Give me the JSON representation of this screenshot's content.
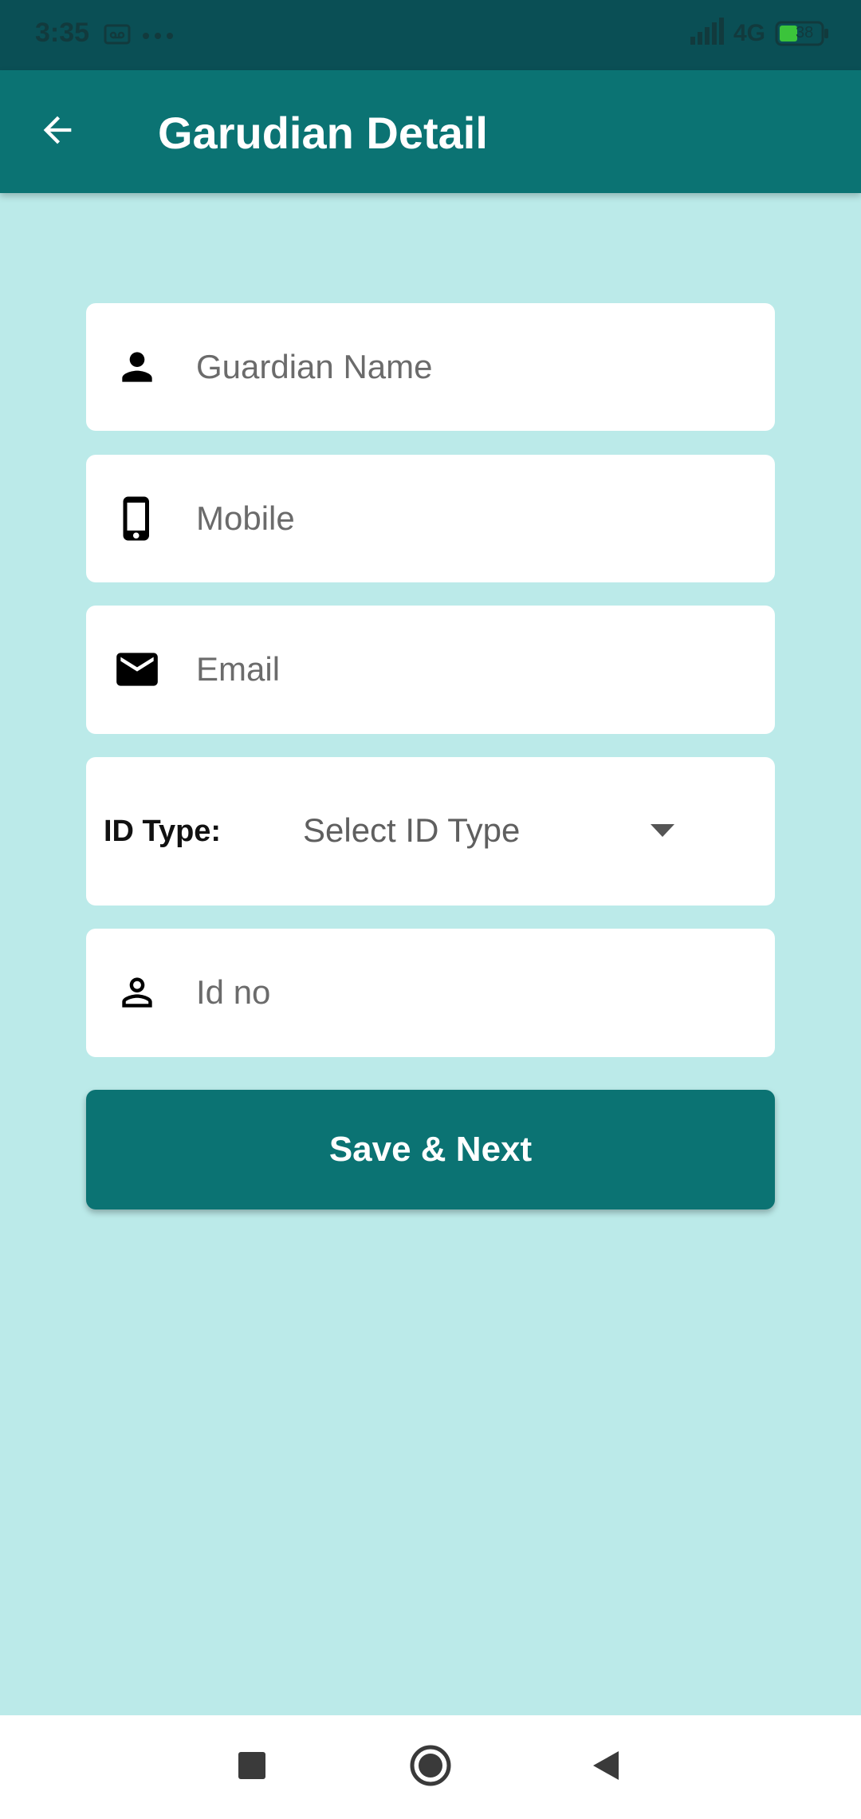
{
  "status_bar": {
    "time": "3:35",
    "network": "4G",
    "battery": "38"
  },
  "app_bar": {
    "title": "Garudian Detail"
  },
  "form": {
    "guardian_name": {
      "placeholder": "Guardian Name",
      "icon": "person-icon"
    },
    "mobile": {
      "placeholder": "Mobile",
      "icon": "smartphone-icon"
    },
    "email": {
      "placeholder": "Email",
      "icon": "mail-icon"
    },
    "id_type": {
      "label": "ID Type:",
      "selected": "Select ID Type"
    },
    "id_no": {
      "placeholder": "Id no",
      "icon": "person-outline-icon"
    }
  },
  "actions": {
    "save_label": "Save & Next"
  },
  "colors": {
    "primary": "#0b7373",
    "status_bar": "#0a4f55",
    "background": "#bbeae9"
  }
}
